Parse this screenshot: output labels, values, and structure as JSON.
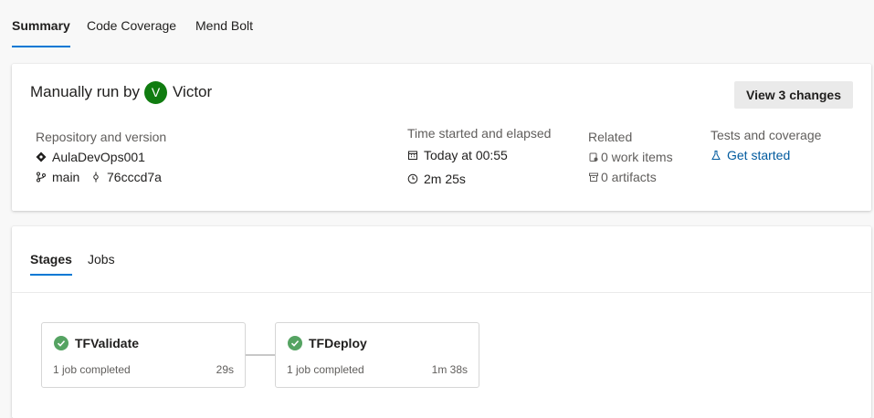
{
  "top_tabs": {
    "summary": "Summary",
    "code_coverage": "Code Coverage",
    "mend_bolt": "Mend Bolt"
  },
  "run": {
    "prefix": "Manually run by",
    "user_initial": "V",
    "user_name": "Victor",
    "avatar_color": "#107c10",
    "view_changes_label": "View 3 changes"
  },
  "repository": {
    "label": "Repository and version",
    "name": "AulaDevOps001",
    "branch": "main",
    "commit": "76cccd7a"
  },
  "time": {
    "label": "Time started and elapsed",
    "started": "Today at 00:55",
    "elapsed": "2m 25s"
  },
  "related": {
    "label": "Related",
    "work_items": "0 work items",
    "artifacts": "0 artifacts"
  },
  "tests": {
    "label": "Tests and coverage",
    "link": "Get started"
  },
  "stage_tabs": {
    "stages": "Stages",
    "jobs": "Jobs"
  },
  "stages": [
    {
      "name": "TFValidate",
      "status": "1 job completed",
      "duration": "29s"
    },
    {
      "name": "TFDeploy",
      "status": "1 job completed",
      "duration": "1m 38s"
    }
  ],
  "colors": {
    "accent": "#0078d4",
    "success": "#55a362",
    "link": "#005a9e"
  }
}
